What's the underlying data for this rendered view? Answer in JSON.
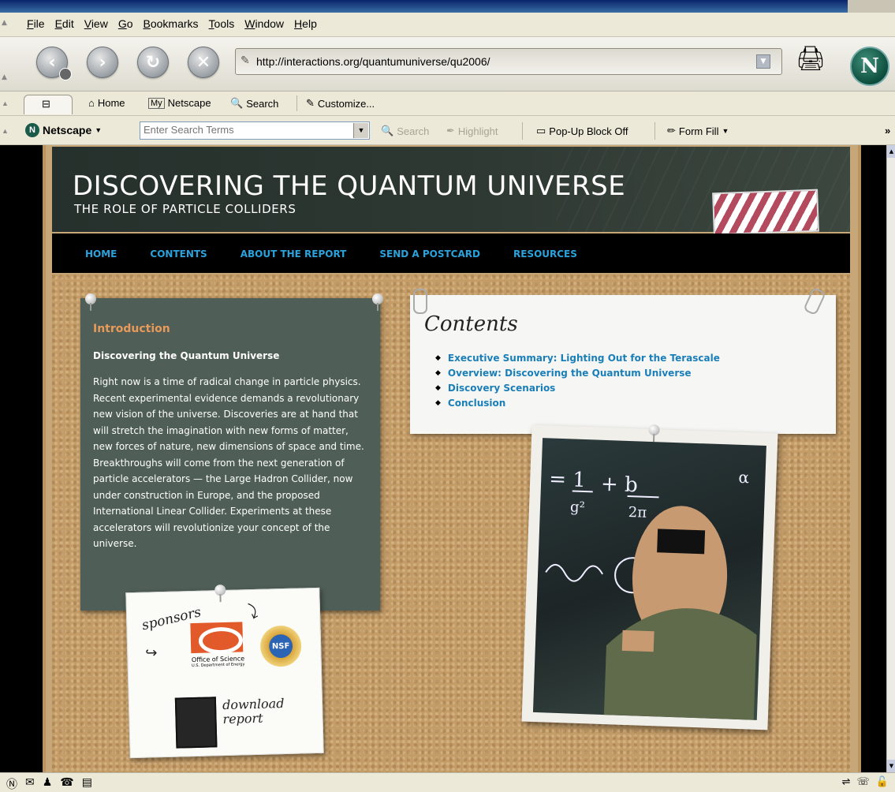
{
  "menu": [
    "File",
    "Edit",
    "View",
    "Go",
    "Bookmarks",
    "Tools",
    "Window",
    "Help"
  ],
  "menu_underline": [
    "F",
    "E",
    "V",
    "G",
    "B",
    "T",
    "W",
    "H"
  ],
  "address": {
    "url": "http://interactions.org/quantumuniverse/qu2006/"
  },
  "personal_toolbar": {
    "home": "Home",
    "my_netscape_badge": "My",
    "my_netscape": "Netscape",
    "search": "Search",
    "customize": "Customize..."
  },
  "search_toolbar": {
    "netscape_menu": "Netscape",
    "placeholder": "Enter Search Terms",
    "search_btn": "Search",
    "highlight_btn": "Highlight",
    "popup": "Pop-Up Block Off",
    "form_fill": "Form Fill",
    "overflow": "»"
  },
  "site": {
    "title": "DISCOVERING THE QUANTUM UNIVERSE",
    "subtitle": "THE ROLE OF PARTICLE COLLIDERS",
    "nav": [
      "HOME",
      "CONTENTS",
      "ABOUT THE REPORT",
      "SEND A POSTCARD",
      "RESOURCES"
    ]
  },
  "intro": {
    "heading": "Introduction",
    "subheading": "Discovering the Quantum Universe",
    "body": "Right now is a time of radical change in particle physics. Recent experimental evidence demands a revolutionary new vision of the universe. Discoveries are at hand that will stretch the imagination with new forms of matter, new forces of nature, new dimensions of space and time. Breakthroughs will come from the next generation of particle accelerators — the Large Hadron Collider, now under construction in Europe, and the proposed International Linear Collider. Experiments at these accelerators will revolutionize your concept of the universe."
  },
  "contents": {
    "title": "Contents",
    "items": [
      "Executive Summary: Lighting Out for the Terascale",
      "Overview: Discovering the Quantum Universe",
      "Discovery Scenarios",
      "Conclusion"
    ]
  },
  "sponsors": {
    "label": "sponsors",
    "doe_line1": "Office of Science",
    "doe_line2": "U.S. Department of Energy",
    "nsf": "NSF",
    "download_line1": "download",
    "download_line2": "report"
  },
  "colors": {
    "nav_link": "#2aa3dd",
    "intro_heading": "#e89a5a",
    "contents_link": "#1a7fb8",
    "intro_bg": "#4f5e57"
  }
}
